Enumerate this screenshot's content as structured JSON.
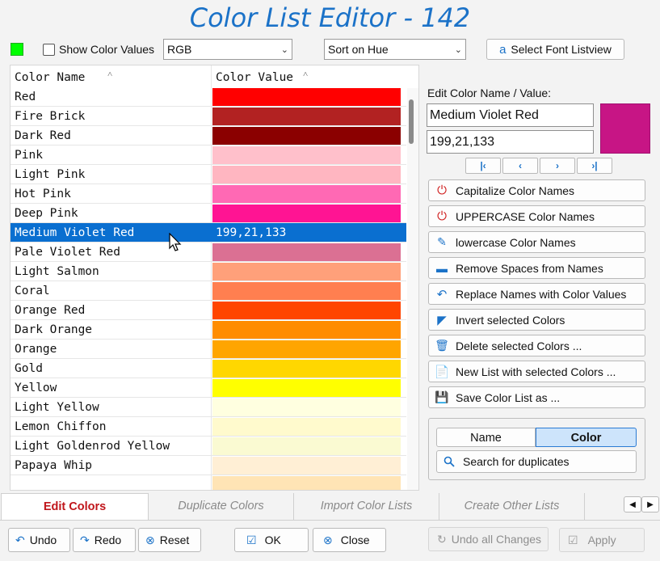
{
  "window": {
    "title": "Color List Editor - 142"
  },
  "toolbar": {
    "show_color_values_label": "Show Color Values",
    "format_select": "RGB",
    "sort_select": "Sort on Hue",
    "select_font_label": "Select Font Listview",
    "indicator_color": "#00ff00"
  },
  "list": {
    "col_name_header": "Color Name",
    "col_value_header": "Color Value",
    "rows": [
      {
        "name": "Red",
        "color": "#ff0000",
        "value": ""
      },
      {
        "name": "Fire Brick",
        "color": "#b22222",
        "value": ""
      },
      {
        "name": "Dark Red",
        "color": "#8b0000",
        "value": ""
      },
      {
        "name": "Pink",
        "color": "#ffc0cb",
        "value": ""
      },
      {
        "name": "Light Pink",
        "color": "#ffb6c1",
        "value": ""
      },
      {
        "name": "Hot Pink",
        "color": "#ff69b4",
        "value": ""
      },
      {
        "name": "Deep Pink",
        "color": "#ff1493",
        "value": ""
      },
      {
        "name": "Medium Violet Red",
        "color": "#c71585",
        "value": "199,21,133",
        "selected": true
      },
      {
        "name": "Pale Violet Red",
        "color": "#db7093",
        "value": ""
      },
      {
        "name": "Light Salmon",
        "color": "#ffa07a",
        "value": ""
      },
      {
        "name": "Coral",
        "color": "#ff7f50",
        "value": ""
      },
      {
        "name": "Orange Red",
        "color": "#ff4500",
        "value": ""
      },
      {
        "name": "Dark Orange",
        "color": "#ff8c00",
        "value": ""
      },
      {
        "name": "Orange",
        "color": "#ffa500",
        "value": ""
      },
      {
        "name": "Gold",
        "color": "#ffd700",
        "value": ""
      },
      {
        "name": "Yellow",
        "color": "#ffff00",
        "value": ""
      },
      {
        "name": "Light Yellow",
        "color": "#ffffe0",
        "value": ""
      },
      {
        "name": "Lemon Chiffon",
        "color": "#fffacd",
        "value": ""
      },
      {
        "name": "Light Goldenrod Yellow",
        "color": "#fafad2",
        "value": ""
      },
      {
        "name": "Papaya Whip",
        "color": "#ffefd5",
        "value": ""
      },
      {
        "name": "",
        "color": "#ffe4b5",
        "value": ""
      }
    ]
  },
  "editor": {
    "label": "Edit Color Name / Value:",
    "name_value": "Medium Violet Red",
    "rgb_value": "199,21,133",
    "preview_color": "#c71585"
  },
  "actions": [
    {
      "label": "Capitalize Color Names",
      "icon": "power-icon"
    },
    {
      "label": "UPPERCASE Color Names",
      "icon": "power-icon"
    },
    {
      "label": "lowercase Color Names",
      "icon": "pen-icon"
    },
    {
      "label": "Remove Spaces from Names",
      "icon": "minus-icon"
    },
    {
      "label": "Replace Names with Color Values",
      "icon": "undo-arrow-icon"
    },
    {
      "label": "Invert selected Colors",
      "icon": "invert-icon"
    },
    {
      "label": "Delete selected Colors ...",
      "icon": "trash-icon"
    },
    {
      "label": "New List with selected Colors ...",
      "icon": "document-icon"
    },
    {
      "label": "Save Color List as ...",
      "icon": "save-icon"
    }
  ],
  "duplicates": {
    "seg_name": "Name",
    "seg_color": "Color",
    "search_label": "Search for duplicates"
  },
  "tabs": [
    "Edit Colors",
    "Duplicate Colors",
    "Import Color Lists",
    "Create Other Lists"
  ],
  "buttons": {
    "undo": "Undo",
    "redo": "Redo",
    "reset": "Reset",
    "ok": "OK",
    "close": "Close",
    "undo_all": "Undo all Changes",
    "apply": "Apply"
  }
}
